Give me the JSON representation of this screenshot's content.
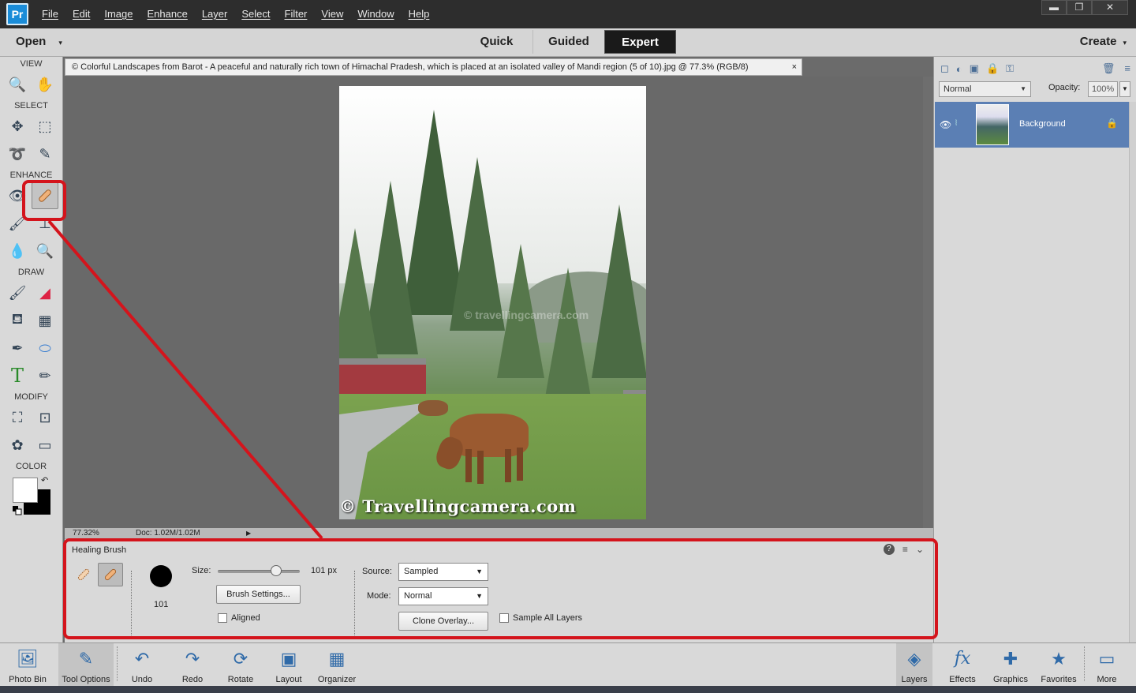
{
  "app": {
    "logo": "Pr"
  },
  "menu": [
    "File",
    "Edit",
    "Image",
    "Enhance",
    "Layer",
    "Select",
    "Filter",
    "View",
    "Window",
    "Help"
  ],
  "window_controls": {
    "minimize": "▬",
    "restore": "❐",
    "close": "✕"
  },
  "modebar": {
    "open_label": "Open",
    "caret": "▾",
    "modes": [
      "Quick",
      "Guided",
      "Expert"
    ],
    "active_mode": "Expert",
    "create_label": "Create"
  },
  "toolbox": {
    "sections": {
      "view": "VIEW",
      "select": "SELECT",
      "enhance": "ENHANCE",
      "draw": "DRAW",
      "modify": "MODIFY",
      "color": "COLOR"
    },
    "tools": {
      "zoom": "🔍",
      "hand": "✋",
      "move": "✥",
      "marquee": "⬚",
      "lasso": "➰",
      "magic_wand": "✎",
      "red_eye": "👁",
      "healing": "✚",
      "smart_brush": "🖌",
      "clone_stamp": "⊥",
      "blur": "💧",
      "sponge": "🔍",
      "brush": "🖌",
      "eraser": "◢",
      "paint_bucket": "⛾",
      "gradient": "▦",
      "eyedropper": "✒",
      "shape": "⬭",
      "type": "T",
      "pencil": "✏",
      "crop": "⛶",
      "recompose": "⊡",
      "content_move": "✿",
      "straighten": "▭"
    },
    "swap_glyph": "↶"
  },
  "document": {
    "tab_title": "© Colorful Landscapes from Barot - A peaceful and naturally rich town of Himachal Pradesh, which is placed at an isolated valley of Mandi region (5 of 10).jpg @ 77.3% (RGB/8)",
    "close": "×",
    "watermark": "© Travellingcamera.com",
    "watermark_faint": "© travellingcamera.com"
  },
  "status": {
    "zoom": "77.32%",
    "doc": "Doc: 1.02M/1.02M",
    "arrow": "▶"
  },
  "tool_options": {
    "title": "Healing Brush",
    "icons": {
      "help": "?",
      "menu": "≡",
      "collapse": "⌄"
    },
    "variants": {
      "spot": "✐",
      "healing": "✐"
    },
    "brush_size_number": "101",
    "size_label": "Size:",
    "size_value": 101,
    "size_text": "101 px",
    "brush_settings_label": "Brush Settings...",
    "aligned_label": "Aligned",
    "source_label": "Source:",
    "source_value": "Sampled",
    "mode_label": "Mode:",
    "mode_value": "Normal",
    "clone_overlay_label": "Clone Overlay...",
    "sample_all_label": "Sample All Layers",
    "select_caret": "▼"
  },
  "layers_panel": {
    "toolbar_icons": [
      "◻",
      "◐",
      "▣",
      "🔒",
      "⚿"
    ],
    "right_icons": [
      "🗑",
      "≡"
    ],
    "blend_mode": "Normal",
    "opacity_label": "Opacity:",
    "opacity_value": "100%",
    "caret": "▼",
    "layers": [
      {
        "name": "Background",
        "eye": "👁",
        "link": "⦚",
        "lock": "🔒"
      }
    ]
  },
  "taskbar": {
    "left": [
      {
        "label": "Photo Bin",
        "icon": "🖼"
      },
      {
        "label": "Tool Options",
        "icon": "✎"
      },
      {
        "label": "Undo",
        "icon": "↶"
      },
      {
        "label": "Redo",
        "icon": "↷"
      },
      {
        "label": "Rotate",
        "icon": "⟳"
      },
      {
        "label": "Layout",
        "icon": "▣"
      },
      {
        "label": "Organizer",
        "icon": "▦"
      }
    ],
    "right": [
      {
        "label": "Layers",
        "icon": "◈"
      },
      {
        "label": "Effects",
        "icon": "fx"
      },
      {
        "label": "Graphics",
        "icon": "✚"
      },
      {
        "label": "Favorites",
        "icon": "★"
      },
      {
        "label": "More",
        "icon": "▭"
      }
    ]
  },
  "colors": {
    "annotation_red": "#d4141c",
    "layer_selected": "#5b7fb4",
    "foreground": "#ffffff",
    "background": "#000000"
  }
}
